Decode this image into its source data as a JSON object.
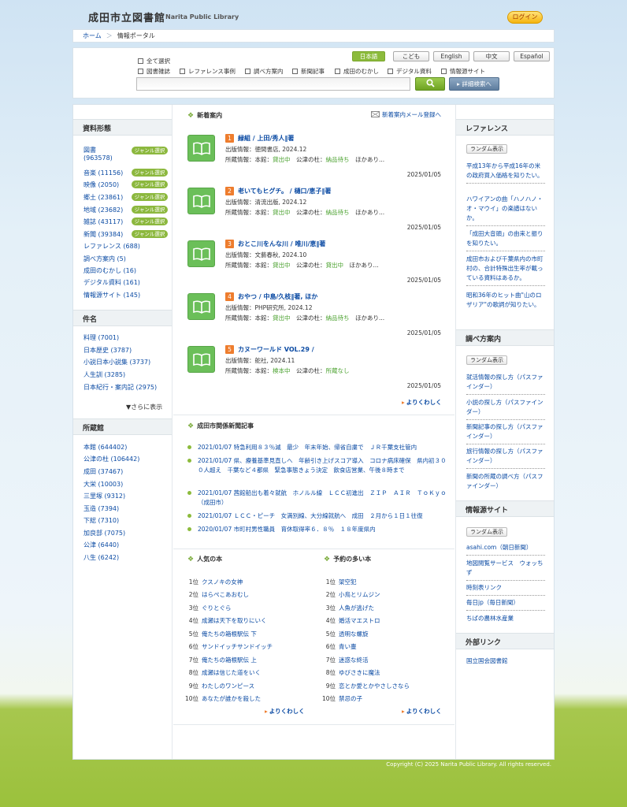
{
  "header": {
    "logo": "成田市立図書館",
    "logo_sub": "Narita Public Library",
    "login": "ログイン"
  },
  "breadcrumb": {
    "home": "ホーム",
    "sep": "＞",
    "current": "情報ポータル"
  },
  "search": {
    "select_all": "全て選択",
    "types": [
      "図書雑誌",
      "レファレンス事例",
      "調べ方案内",
      "新聞記事",
      "成田のむかし",
      "デジタル資料",
      "情報源サイト"
    ],
    "languages": [
      "日本語",
      "こども",
      "English",
      "中文",
      "Español"
    ],
    "submit_icon": "search-icon",
    "advanced": "詳細検索へ"
  },
  "left": {
    "material_title": "資料形態",
    "genre_tag": "ジャンル選択",
    "materials": [
      {
        "label": "図書",
        "count": "(963578)"
      },
      {
        "label": "音楽",
        "count": "(11156)"
      },
      {
        "label": "映像",
        "count": "(2050)"
      },
      {
        "label": "郷土",
        "count": "(23861)"
      },
      {
        "label": "地域",
        "count": "(23682)"
      },
      {
        "label": "雑誌",
        "count": "(43117)"
      },
      {
        "label": "新聞",
        "count": "(39384)"
      },
      {
        "label": "レファレンス",
        "count": "(688)"
      },
      {
        "label": "調べ方案内",
        "count": "(5)"
      },
      {
        "label": "成田のむかし",
        "count": "(16)"
      },
      {
        "label": "デジタル資料",
        "count": "(161)"
      },
      {
        "label": "情報源サイト",
        "count": "(145)"
      }
    ],
    "subject_title": "件名",
    "subjects": [
      "料理 (7001)",
      "日本歴史 (3787)",
      "小説日本小説集 (3737)",
      "人生訓 (3285)",
      "日本紀行・案内記 (2975)"
    ],
    "more": "▼さらに表示",
    "branch_title": "所蔵館",
    "branches": [
      "本館 (644402)",
      "公津の杜 (106442)",
      "成田 (37467)",
      "大栄 (10003)",
      "三里塚 (9312)",
      "玉造 (7394)",
      "下総 (7310)",
      "加良部 (7075)",
      "公津 (6440)",
      "八生 (6242)"
    ]
  },
  "new_arrivals": {
    "title": "新着案内",
    "mail": "新着案内メール登録へ",
    "items": [
      {
        "num": "1",
        "title": "緑組 / 上田/秀人‖著",
        "pub": "出版情報：徳間書店, 2024.12",
        "hold_a": "所蔵情報：本館：",
        "st_a": "貸出中",
        "hold_b": "公津の杜：",
        "st_b": "納品待ち",
        "tail": "ほかあり...",
        "date": "2025/01/05"
      },
      {
        "num": "2",
        "title": "老いてもヒグチ。 / 樋口/恵子‖著",
        "pub": "出版情報：清流出版, 2024.12",
        "hold_a": "所蔵情報：本館：",
        "st_a": "貸出中",
        "hold_b": "公津の杜：",
        "st_b": "納品待ち",
        "tail": "ほかあり...",
        "date": "2025/01/05"
      },
      {
        "num": "3",
        "title": "おとこ川をんな川 / 唯川/恵‖著",
        "pub": "出版情報：文藝春秋, 2024.10",
        "hold_a": "所蔵情報：本館：",
        "st_a": "貸出中",
        "hold_b": "公津の杜：",
        "st_b": "貸出中",
        "tail": "ほかあり...",
        "date": "2025/01/05"
      },
      {
        "num": "4",
        "title": "おやつ / 中島/久枝‖著, ほか",
        "pub": "出版情報：PHP研究所, 2024.12",
        "hold_a": "所蔵情報：本館：",
        "st_a": "貸出中",
        "hold_b": "公津の杜：",
        "st_b": "納品待ち",
        "tail": "ほかあり...",
        "date": "2025/01/05"
      },
      {
        "num": "5",
        "title": "カヌーワールド VOL.29 /",
        "pub": "出版情報：舵社, 2024.11",
        "hold_a": "所蔵情報：本館：",
        "st_a": "検本中",
        "hold_b": "公津の杜：",
        "st_b": "所蔵なし",
        "tail": "",
        "date": "2025/01/05"
      }
    ],
    "more": "よりくわしく"
  },
  "news": {
    "title": "成田市関係新聞記事",
    "items": [
      "2021/01/07 特急利用８３％減　最少　年末年始、帰省自粛で　ＪＲ千葉支社管内",
      "2021/01/07 県、療養基準見直しへ　年齢引き上げスコア導入　コロナ病床確保　県内初３００人超え　千葉など４都県　緊急事態きょう決定　飲食店営業、午後８時まで",
      "2021/01/07 茜館船出も着々就航　ホノルル線　ＬＣＣ初進出　ＺＩＰ　ＡＩＲ　ＴｏＫｙｏ（成田市）",
      "2021/01/07 ＬＣＣ・ピーチ　女満別線、大分線就航へ　成田　２月から１日１往復",
      "2020/01/07 市町村男性職員　育休取得率６．８％　１８年度県内"
    ]
  },
  "popular": {
    "title": "人気の本",
    "items": [
      {
        "rank": "1位",
        "title": "クスノキの女神"
      },
      {
        "rank": "2位",
        "title": "はらぺこあおむし"
      },
      {
        "rank": "3位",
        "title": "ぐりとぐら"
      },
      {
        "rank": "4位",
        "title": "成瀬は天下を取りにいく"
      },
      {
        "rank": "5位",
        "title": "俺たちの箱根駅伝 下"
      },
      {
        "rank": "6位",
        "title": "サンドイッチサンドイッチ"
      },
      {
        "rank": "7位",
        "title": "俺たちの箱根駅伝 上"
      },
      {
        "rank": "8位",
        "title": "成瀬は信じた道をいく"
      },
      {
        "rank": "9位",
        "title": "わたしのワンピース"
      },
      {
        "rank": "10位",
        "title": "あなたが誰かを殺した"
      }
    ],
    "more": "よりくわしく"
  },
  "reserved": {
    "title": "予約の多い本",
    "items": [
      {
        "rank": "1位",
        "title": "架空犯"
      },
      {
        "rank": "2位",
        "title": "小鳥とリムジン"
      },
      {
        "rank": "3位",
        "title": "人魚が逃げた"
      },
      {
        "rank": "4位",
        "title": "婚活マエストロ"
      },
      {
        "rank": "5位",
        "title": "透明な螺旋"
      },
      {
        "rank": "6位",
        "title": "青い壷"
      },
      {
        "rank": "7位",
        "title": "迷惑な終活"
      },
      {
        "rank": "8位",
        "title": "ゆびさきに魔法"
      },
      {
        "rank": "9位",
        "title": "恋とか愛とかやさしさなら"
      },
      {
        "rank": "10位",
        "title": "禁忌の子"
      }
    ],
    "more": "よりくわしく"
  },
  "right": {
    "random": "ランダム表示",
    "reference_title": "レファレンス",
    "reference": [
      "平成13年から平成16年の米の政府買入価格を知りたい。",
      "ハワイアンの曲「ハノハノ・オ・マウイ」の楽譜はないか。",
      "「成田大音頭」の由来と振りを知りたい。",
      "成田市および千葉県内の市町村の、合計特殊出生率が載っている資料はあるか。",
      "昭和36年のヒット曲\"山のロザリア\"の歌詞が知りたい。"
    ],
    "guide_title": "調べ方案内",
    "guide": [
      "就活情報の探し方（パスファインダー）",
      "小説の探し方（パスファインダー）",
      "新聞記事の探し方（パスファインダー）",
      "旅行情報の探し方（パスファインダー）",
      "新聞の所蔵の調べ方（パスファインダー）"
    ],
    "sites_title": "情報源サイト",
    "sites": [
      "asahi.com（朝日新聞）",
      "地図閲覧サービス　ウォッちず",
      "時刻表リンク",
      "毎日jp（毎日新聞）",
      "ちばの農林水産業"
    ],
    "links_title": "外部リンク",
    "links": [
      "国立国会図書館"
    ]
  },
  "footer": {
    "copyright": "Copyright (C) 2025 Narita Public Library. All rights reserved."
  }
}
